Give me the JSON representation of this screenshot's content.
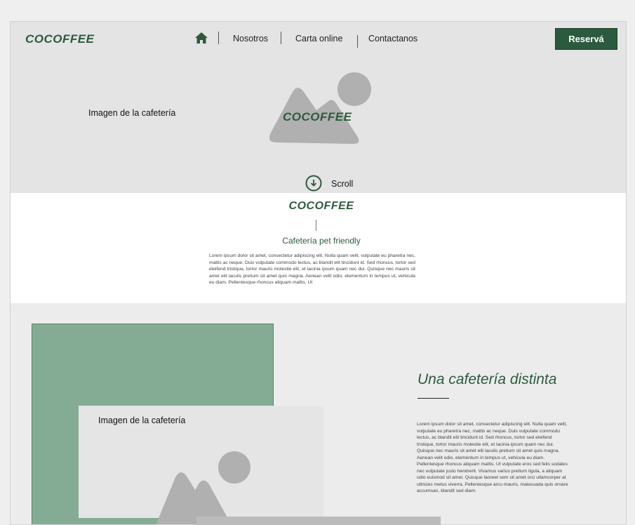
{
  "header": {
    "logo": "COCOFFEE",
    "nav": {
      "home_icon": "home-icon",
      "items": [
        "Nosotros",
        "Carta online",
        "Contactanos"
      ]
    },
    "cta_label": "Reservá"
  },
  "hero": {
    "image_caption": "Imagen de la cafetería",
    "title": "COCOFFEE",
    "scroll_label": "Scroll",
    "scroll_icon": "arrow-down-circle-icon"
  },
  "intro": {
    "title": "COCOFFEE",
    "subtitle": "Cafetería pet friendly",
    "body": "Lorem ipsum dolor sit amet, consectetur adipiscing elit. Nulla quam velit, vulputate eu pharetra nec, mattis ac neque. Duis vulputate commodo lectus, ac blandit elit tincidunt id. Sed rhoncus, tortor sed eleifend tristique, tortor mauris molestie elit, et lacinia ipsum quam nec dui. Quisque nec mauris sit amet elit iaculis pretium sit amet quis magna. Aenean velit odio, elementum in tempus ut, vehicula eu diam. Pellentesque rhoncus aliquam mattis. Ut"
  },
  "feature": {
    "image_caption": "Imagen de la cafetería",
    "title": "Una cafetería distinta",
    "body": "Lorem ipsum dolor sit amet, consectetur adipiscing elit. Nulla quam velit, vulputate eu pharetra nec, mattis ac neque. Duis vulputate commodo lectus, ac blandit elit tincidunt id. Sed rhoncus, tortor sed eleifend tristique, tortor mauris molestie elit, et lacinia ipsum quam nec dui. Quisque nec mauris sit amet elit iaculis pretium sit amet quis magna. Aenean velit odio, elementum in tempus ut, vehicula eu diam. Pellentesque rhoncus aliquam mattis. Ut vulputate eros sed felis sodales nec vulputate justo hendrerit. Vivamus varius pretium ligula, a aliquam odio euismod sit amet. Quisque laoreet sem sit amet orci ullamcorper at ultricies metus viverra. Pellentesque arcu mauris, malesuada quis ornare accumsan, blandit sed diam."
  },
  "colors": {
    "brand_green": "#2d5a3d",
    "cta_green": "#2b5a3e",
    "accent_green_block": "#84ac95",
    "placeholder_gray": "#b0b0b0"
  }
}
